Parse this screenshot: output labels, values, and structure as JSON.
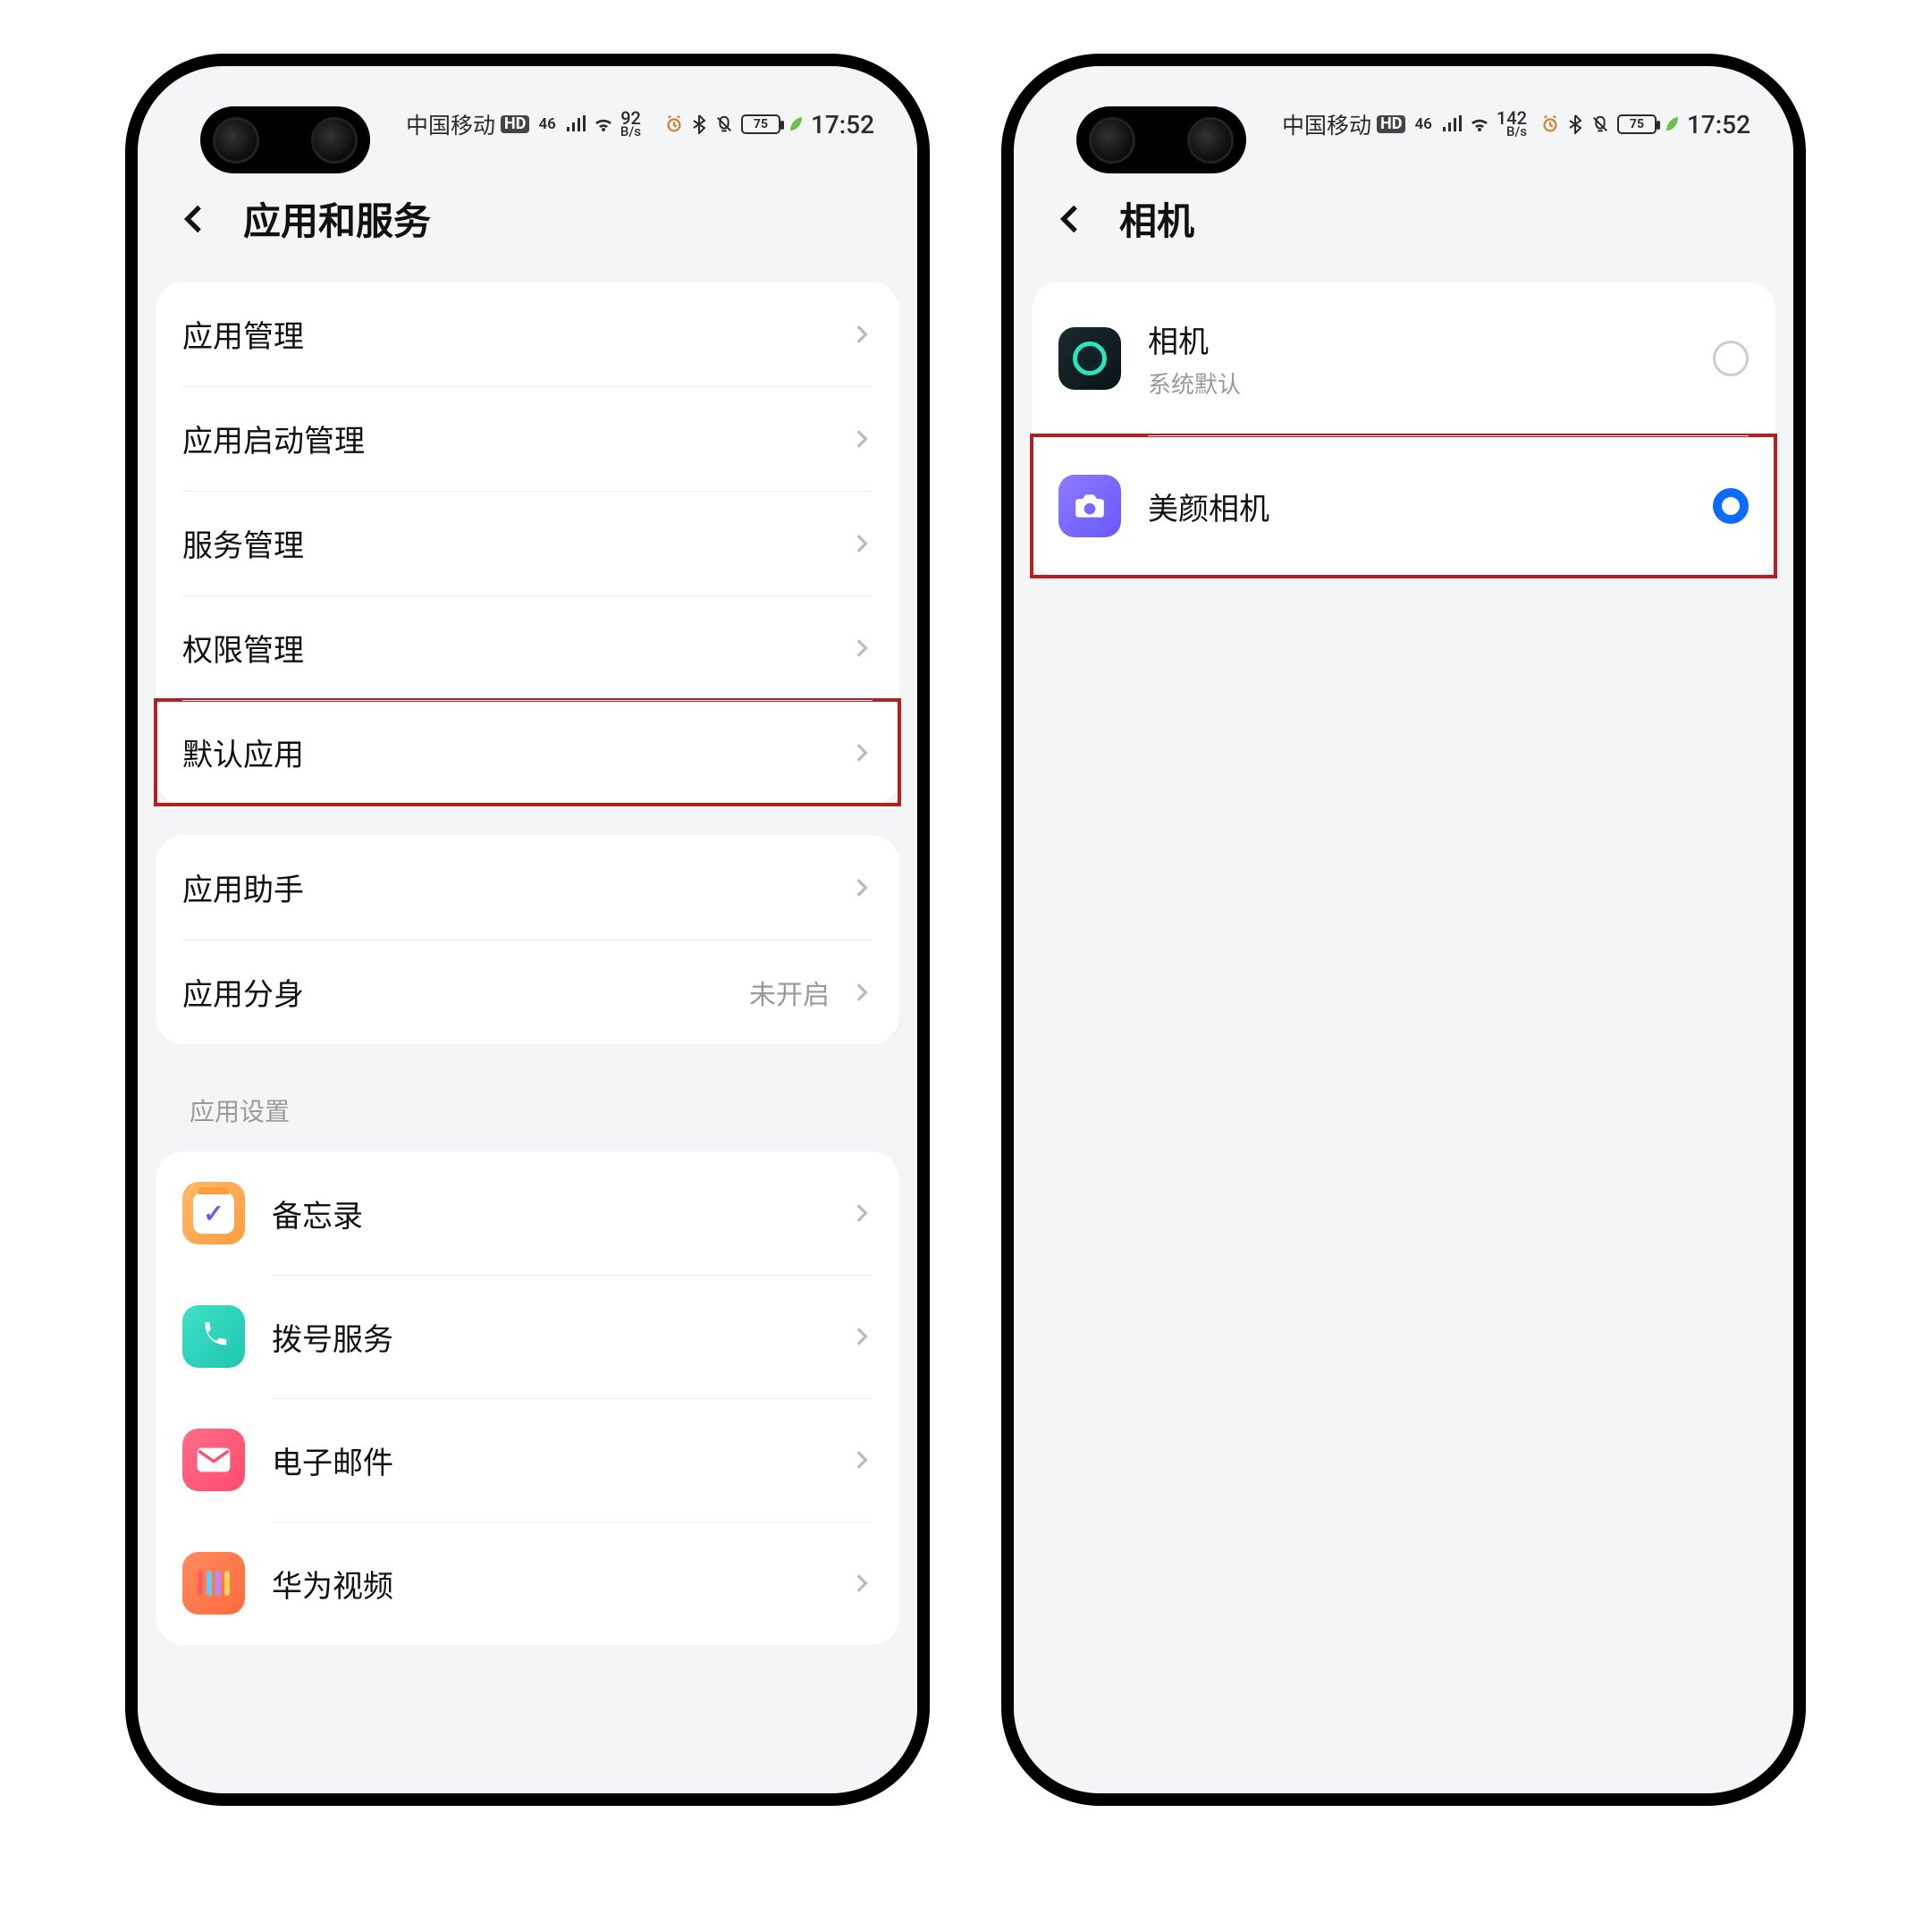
{
  "status": {
    "carrier": "中国移动",
    "hd_badge": "HD",
    "net_badge": "46",
    "speed1_num": "92",
    "speed1_unit": "B/s",
    "speed2_num": "142",
    "speed2_unit": "B/s",
    "battery": "75",
    "time": "17:52"
  },
  "left": {
    "title": "应用和服务",
    "group1": {
      "app_manage": "应用管理",
      "launch_manage": "应用启动管理",
      "service_manage": "服务管理",
      "perm_manage": "权限管理",
      "default_apps": "默认应用"
    },
    "group2": {
      "assistant": "应用助手",
      "twin_apps": "应用分身",
      "twin_value": "未开启"
    },
    "section_label": "应用设置",
    "apps": {
      "notes": "备忘录",
      "dialer": "拨号服务",
      "email": "电子邮件",
      "video": "华为视频"
    }
  },
  "right": {
    "title": "相机",
    "option1": {
      "name": "相机",
      "sub": "系统默认"
    },
    "option2": {
      "name": "美颜相机"
    }
  }
}
